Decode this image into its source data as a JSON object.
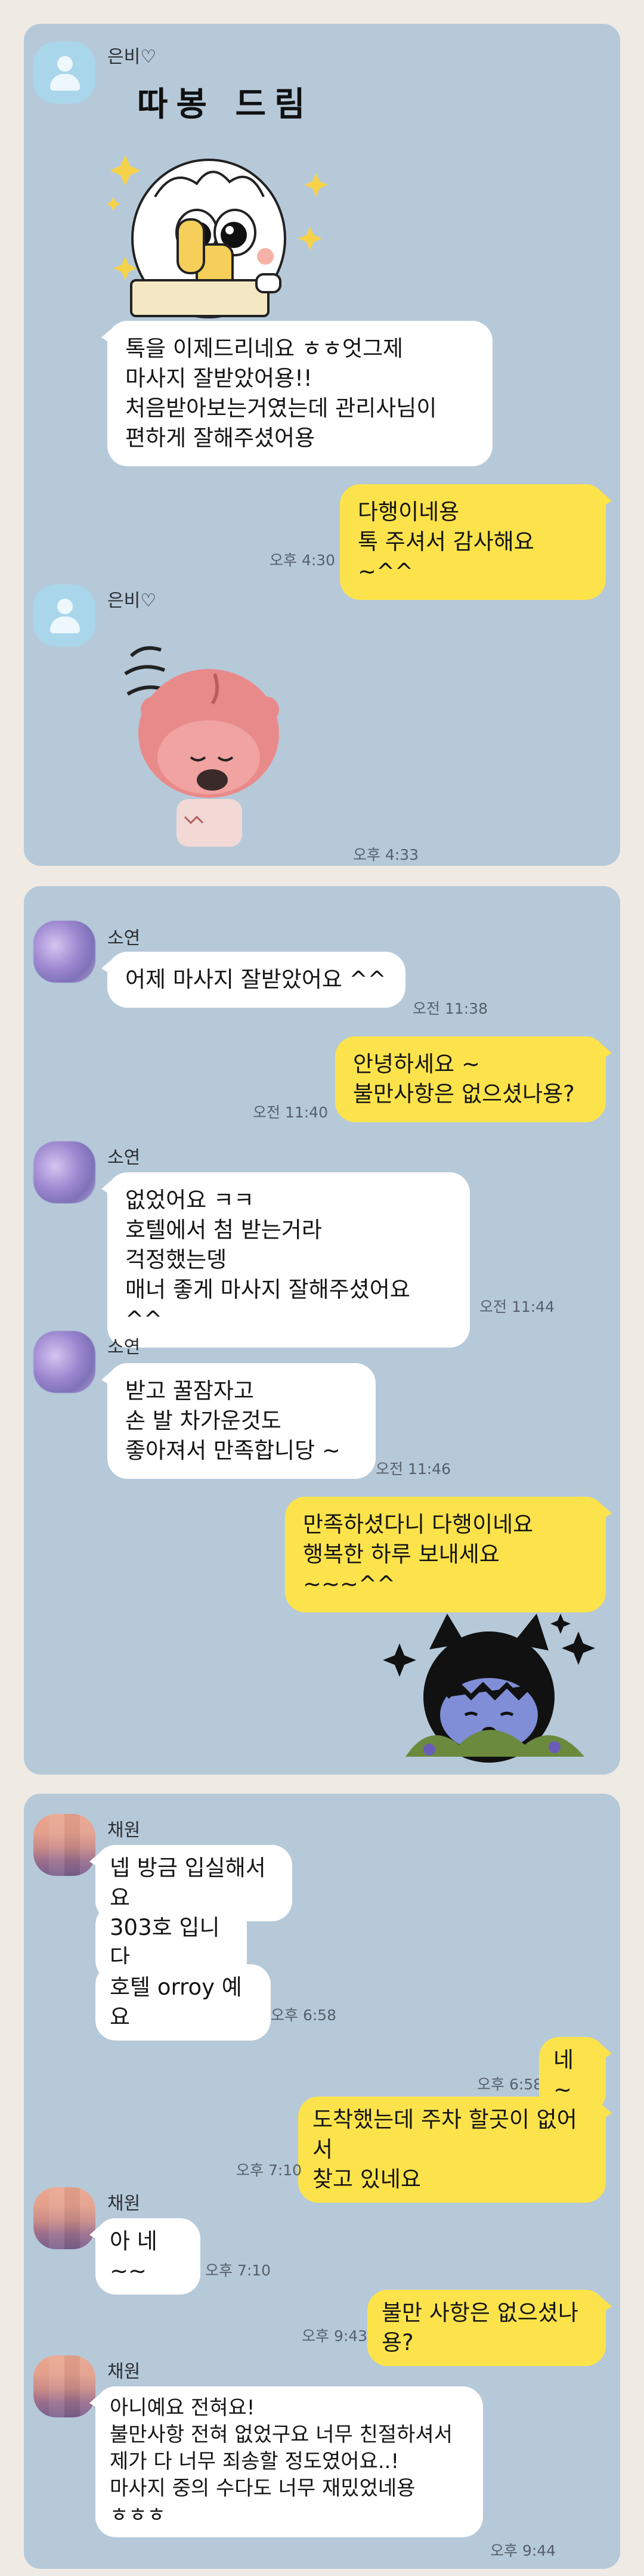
{
  "chat1": {
    "sender": "은비♡",
    "sticker_caption": "따봉 드림",
    "message": "톡을 이제드리네요 ㅎㅎ엇그제\n마사지 잘받았어용!!\n처음받아보는거였는데 관리사님이\n편하게 잘해주셨어용",
    "reply": "다행이네용\n톡 주셔서 감사해요 ~^^",
    "reply_time": "오후 4:30",
    "sender2": "은비♡",
    "sticker_time": "오후 4:33"
  },
  "chat2": {
    "sender": "소연",
    "msg1": "어제 마사지 잘받았어요 ^^",
    "msg1_time": "오전 11:38",
    "reply1": "안녕하세요 ~\n불만사항은 없으셨나용?",
    "reply1_time": "오전 11:40",
    "sender_b": "소연",
    "msg2": "없었어요 ㅋㅋ\n호텔에서 첨 받는거라\n걱정했는뎅\n매너 좋게 마사지 잘해주셨어요 ^^",
    "msg2_time": "오전 11:44",
    "sender_c": "소연",
    "msg3": "받고 꿀잠자고\n손 발 차가운것도\n좋아져서 만족합니당 ~",
    "msg3_time": "오전 11:46",
    "reply2": "만족하셨다니 다행이네요\n행복한 하루 보내세요 ~~~^^"
  },
  "chat3": {
    "sender": "채원",
    "msg1": "넵 방금 입실해서요",
    "msg2": "303호 입니다",
    "msg3": "호텔 orroy 예요",
    "msg3_time": "오후 6:58",
    "reply1": "네 ~",
    "reply1_time": "오후 6:58",
    "reply2": "도착했는데  주차 할곳이 없어서\n찾고 있네요",
    "reply2_time": "오후 7:10",
    "sender_b": "채원",
    "msg4": "아 네~~",
    "msg4_time": "오후 7:10",
    "reply3": "불만 사항은 없으셨나용?",
    "reply3_time": "오후 9:43",
    "sender_c": "채원",
    "msg5": "아니예요 전혀요!\n불만사항 전혀 없었구요 너무 친절하셔서\n제가 다 너무 죄송할 정도였어요..!\n마사지 중의 수다도 너무 재밌었네용\nㅎㅎㅎ",
    "msg5_time": "오후 9:44"
  },
  "colors": {
    "chat_background": "#b6c9d9",
    "my_bubble": "#fde34b",
    "their_bubble": "#ffffff",
    "page_background": "#efeae4"
  },
  "icons": {
    "default_avatar": "person-silhouette-icon",
    "sticker1": "thumbs-up-character-sticker",
    "sticker2": "bowing-pink-character-sticker",
    "sticker3": "sparkling-cat-character-sticker"
  }
}
